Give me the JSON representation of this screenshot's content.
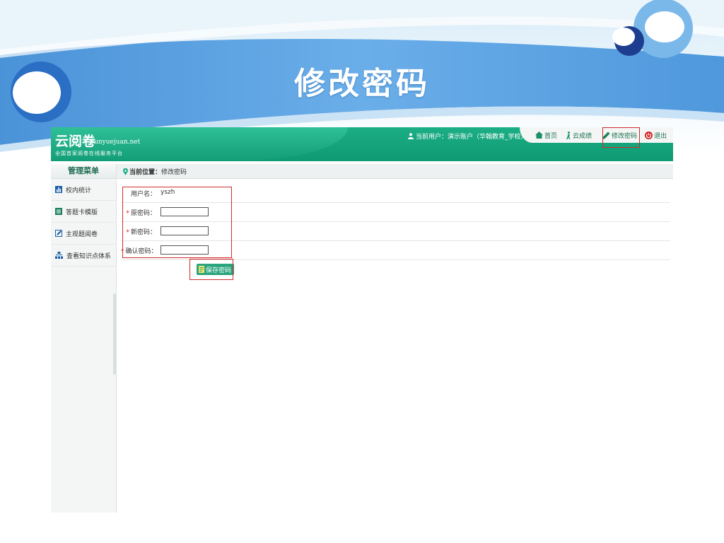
{
  "slide": {
    "title": "修改密码"
  },
  "app": {
    "logo": {
      "name": "云阅卷",
      "url": "yunyuejuan.net",
      "tagline": "全国首家阅卷在线服务平台"
    },
    "user_info": "当前用户：演示账户（华翰教育_学校）",
    "nav": {
      "home": "首页",
      "cloud_score": "云成绩",
      "change_password": "修改密码",
      "logout": "退出"
    },
    "breadcrumb": {
      "prefix": "当前位置：",
      "page": "修改密码"
    },
    "sidebar": {
      "title": "管理菜单",
      "items": [
        {
          "label": "校内统计",
          "icon": "bar-chart-icon"
        },
        {
          "label": "答题卡模版",
          "icon": "document-icon"
        },
        {
          "label": "主观题阅卷",
          "icon": "pen-grading-icon"
        },
        {
          "label": "查看知识点体系",
          "icon": "hierarchy-icon"
        }
      ]
    },
    "form": {
      "username_label": "用户名：",
      "username_value": "yszh",
      "old_password_label": "原密码：",
      "new_password_label": "新密码：",
      "confirm_password_label": "确认密码：",
      "required_mark": "*",
      "old_password_value": "",
      "new_password_value": "",
      "confirm_password_value": ""
    },
    "save_button": "保存密码"
  },
  "colors": {
    "banner_blue": "#5fa6e6",
    "header_green": "#14a27a",
    "highlight_red": "#d32a2a"
  }
}
